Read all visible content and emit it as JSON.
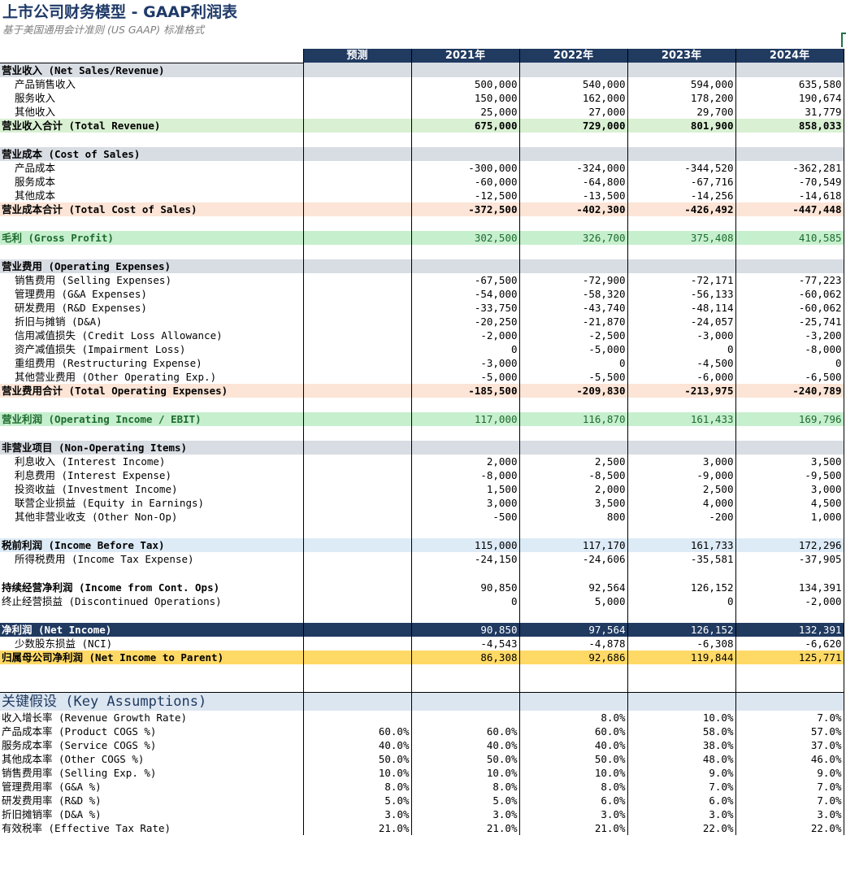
{
  "title": "上市公司财务模型 - GAAP利润表",
  "subtitle": "基于美国通用会计准则 (US GAAP) 标准格式",
  "header": [
    "预测",
    "2021年",
    "2022年",
    "2023年",
    "2024年"
  ],
  "rows": [
    {
      "type": "section",
      "label": "营业收入 (Net Sales/Revenue)",
      "v": [
        "",
        "",
        "",
        "",
        ""
      ]
    },
    {
      "type": "item",
      "label": "产品销售收入",
      "v": [
        "",
        "500,000",
        "540,000",
        "594,000",
        "635,580"
      ]
    },
    {
      "type": "item",
      "label": "服务收入",
      "v": [
        "",
        "150,000",
        "162,000",
        "178,200",
        "190,674"
      ]
    },
    {
      "type": "item",
      "label": "其他收入",
      "v": [
        "",
        "25,000",
        "27,000",
        "29,700",
        "31,779"
      ]
    },
    {
      "type": "total-green",
      "label": "营业收入合计 (Total Revenue)",
      "v": [
        "",
        "675,000",
        "729,000",
        "801,900",
        "858,033"
      ]
    },
    {
      "type": "blank",
      "label": "",
      "v": [
        "",
        "",
        "",
        "",
        ""
      ]
    },
    {
      "type": "section",
      "label": "营业成本 (Cost of Sales)",
      "v": [
        "",
        "",
        "",
        "",
        ""
      ]
    },
    {
      "type": "item",
      "label": "产品成本",
      "v": [
        "",
        "-300,000",
        "-324,000",
        "-344,520",
        "-362,281"
      ]
    },
    {
      "type": "item",
      "label": "服务成本",
      "v": [
        "",
        "-60,000",
        "-64,800",
        "-67,716",
        "-70,549"
      ]
    },
    {
      "type": "item",
      "label": "其他成本",
      "v": [
        "",
        "-12,500",
        "-13,500",
        "-14,256",
        "-14,618"
      ]
    },
    {
      "type": "total-peach",
      "label": "营业成本合计 (Total Cost of Sales)",
      "v": [
        "",
        "-372,500",
        "-402,300",
        "-426,492",
        "-447,448"
      ]
    },
    {
      "type": "blank",
      "label": "",
      "v": [
        "",
        "",
        "",
        "",
        ""
      ]
    },
    {
      "type": "gross",
      "label": "毛利 (Gross Profit)",
      "v": [
        "",
        "302,500",
        "326,700",
        "375,408",
        "410,585"
      ]
    },
    {
      "type": "blank",
      "label": "",
      "v": [
        "",
        "",
        "",
        "",
        ""
      ]
    },
    {
      "type": "section",
      "label": "营业费用 (Operating Expenses)",
      "v": [
        "",
        "",
        "",
        "",
        ""
      ]
    },
    {
      "type": "item",
      "label": "销售费用 (Selling Expenses)",
      "v": [
        "",
        "-67,500",
        "-72,900",
        "-72,171",
        "-77,223"
      ]
    },
    {
      "type": "item",
      "label": "管理费用 (G&A Expenses)",
      "v": [
        "",
        "-54,000",
        "-58,320",
        "-56,133",
        "-60,062"
      ]
    },
    {
      "type": "item",
      "label": "研发费用 (R&D Expenses)",
      "v": [
        "",
        "-33,750",
        "-43,740",
        "-48,114",
        "-60,062"
      ]
    },
    {
      "type": "item",
      "label": "折旧与摊销 (D&A)",
      "v": [
        "",
        "-20,250",
        "-21,870",
        "-24,057",
        "-25,741"
      ]
    },
    {
      "type": "item",
      "label": "信用减值损失 (Credit Loss Allowance)",
      "v": [
        "",
        "-2,000",
        "-2,500",
        "-3,000",
        "-3,200"
      ]
    },
    {
      "type": "item",
      "label": "资产减值损失 (Impairment Loss)",
      "v": [
        "",
        "0",
        "-5,000",
        "0",
        "-8,000"
      ]
    },
    {
      "type": "item",
      "label": "重组费用 (Restructuring Expense)",
      "v": [
        "",
        "-3,000",
        "0",
        "-4,500",
        "0"
      ]
    },
    {
      "type": "item",
      "label": "其他营业费用 (Other Operating Exp.)",
      "v": [
        "",
        "-5,000",
        "-5,500",
        "-6,000",
        "-6,500"
      ]
    },
    {
      "type": "total-peach",
      "label": "营业费用合计 (Total Operating Expenses)",
      "v": [
        "",
        "-185,500",
        "-209,830",
        "-213,975",
        "-240,789"
      ]
    },
    {
      "type": "blank",
      "label": "",
      "v": [
        "",
        "",
        "",
        "",
        ""
      ]
    },
    {
      "type": "gross",
      "label": "营业利润 (Operating Income / EBIT)",
      "v": [
        "",
        "117,000",
        "116,870",
        "161,433",
        "169,796"
      ]
    },
    {
      "type": "blank",
      "label": "",
      "v": [
        "",
        "",
        "",
        "",
        ""
      ]
    },
    {
      "type": "section",
      "label": "非营业项目 (Non-Operating Items)",
      "v": [
        "",
        "",
        "",
        "",
        ""
      ]
    },
    {
      "type": "item",
      "label": "利息收入 (Interest Income)",
      "v": [
        "",
        "2,000",
        "2,500",
        "3,000",
        "3,500"
      ]
    },
    {
      "type": "item",
      "label": "利息费用 (Interest Expense)",
      "v": [
        "",
        "-8,000",
        "-8,500",
        "-9,000",
        "-9,500"
      ]
    },
    {
      "type": "item",
      "label": "投资收益 (Investment Income)",
      "v": [
        "",
        "1,500",
        "2,000",
        "2,500",
        "3,000"
      ]
    },
    {
      "type": "item",
      "label": "联营企业损益 (Equity in Earnings)",
      "v": [
        "",
        "3,000",
        "3,500",
        "4,000",
        "4,500"
      ]
    },
    {
      "type": "item",
      "label": "其他非营业收支 (Other Non-Op)",
      "v": [
        "",
        "-500",
        "800",
        "-200",
        "1,000"
      ]
    },
    {
      "type": "blank",
      "label": "",
      "v": [
        "",
        "",
        "",
        "",
        ""
      ]
    },
    {
      "type": "light",
      "label": "税前利润 (Income Before Tax)",
      "v": [
        "",
        "115,000",
        "117,170",
        "161,733",
        "172,296"
      ]
    },
    {
      "type": "item",
      "label": "所得税费用 (Income Tax Expense)",
      "v": [
        "",
        "-24,150",
        "-24,606",
        "-35,581",
        "-37,905"
      ]
    },
    {
      "type": "blank",
      "label": "",
      "v": [
        "",
        "",
        "",
        "",
        ""
      ]
    },
    {
      "type": "bold",
      "label": "持续经营净利润 (Income from Cont. Ops)",
      "v": [
        "",
        "90,850",
        "92,564",
        "126,152",
        "134,391"
      ]
    },
    {
      "type": "plain",
      "label": "终止经营损益 (Discontinued Operations)",
      "v": [
        "",
        "0",
        "5,000",
        "0",
        "-2,000"
      ]
    },
    {
      "type": "blank",
      "label": "",
      "v": [
        "",
        "",
        "",
        "",
        ""
      ]
    },
    {
      "type": "net",
      "label": "净利润 (Net Income)",
      "v": [
        "",
        "90,850",
        "97,564",
        "126,152",
        "132,391"
      ]
    },
    {
      "type": "item",
      "label": "少数股东损益 (NCI)",
      "v": [
        "",
        "-4,543",
        "-4,878",
        "-6,308",
        "-6,620"
      ]
    },
    {
      "type": "parent",
      "label": "归属母公司净利润 (Net Income to Parent)",
      "v": [
        "",
        "86,308",
        "92,686",
        "119,844",
        "125,771"
      ]
    },
    {
      "type": "blank",
      "label": "",
      "v": [
        "",
        "",
        "",
        "",
        ""
      ]
    },
    {
      "type": "blank2",
      "label": "",
      "v": [
        "",
        "",
        "",
        "",
        ""
      ]
    },
    {
      "type": "assume",
      "label": "关键假设 (Key Assumptions)",
      "v": [
        "",
        "",
        "",
        "",
        ""
      ]
    },
    {
      "type": "plain",
      "label": "收入增长率 (Revenue Growth Rate)",
      "v": [
        "",
        "",
        "8.0%",
        "10.0%",
        "7.0%"
      ]
    },
    {
      "type": "plain",
      "label": "产品成本率 (Product COGS %)",
      "v": [
        "60.0%",
        "60.0%",
        "60.0%",
        "58.0%",
        "57.0%"
      ]
    },
    {
      "type": "plain",
      "label": "服务成本率 (Service COGS %)",
      "v": [
        "40.0%",
        "40.0%",
        "40.0%",
        "38.0%",
        "37.0%"
      ]
    },
    {
      "type": "plain",
      "label": "其他成本率 (Other COGS %)",
      "v": [
        "50.0%",
        "50.0%",
        "50.0%",
        "48.0%",
        "46.0%"
      ]
    },
    {
      "type": "plain",
      "label": "销售费用率 (Selling Exp. %)",
      "v": [
        "10.0%",
        "10.0%",
        "10.0%",
        "9.0%",
        "9.0%"
      ]
    },
    {
      "type": "plain",
      "label": "管理费用率 (G&A %)",
      "v": [
        "8.0%",
        "8.0%",
        "8.0%",
        "7.0%",
        "7.0%"
      ]
    },
    {
      "type": "plain",
      "label": "研发费用率 (R&D %)",
      "v": [
        "5.0%",
        "5.0%",
        "6.0%",
        "6.0%",
        "7.0%"
      ]
    },
    {
      "type": "plain",
      "label": "折旧摊销率 (D&A %)",
      "v": [
        "3.0%",
        "3.0%",
        "3.0%",
        "3.0%",
        "3.0%"
      ]
    },
    {
      "type": "plain",
      "label": "有效税率 (Effective Tax Rate)",
      "v": [
        "21.0%",
        "21.0%",
        "21.0%",
        "22.0%",
        "22.0%"
      ]
    }
  ]
}
